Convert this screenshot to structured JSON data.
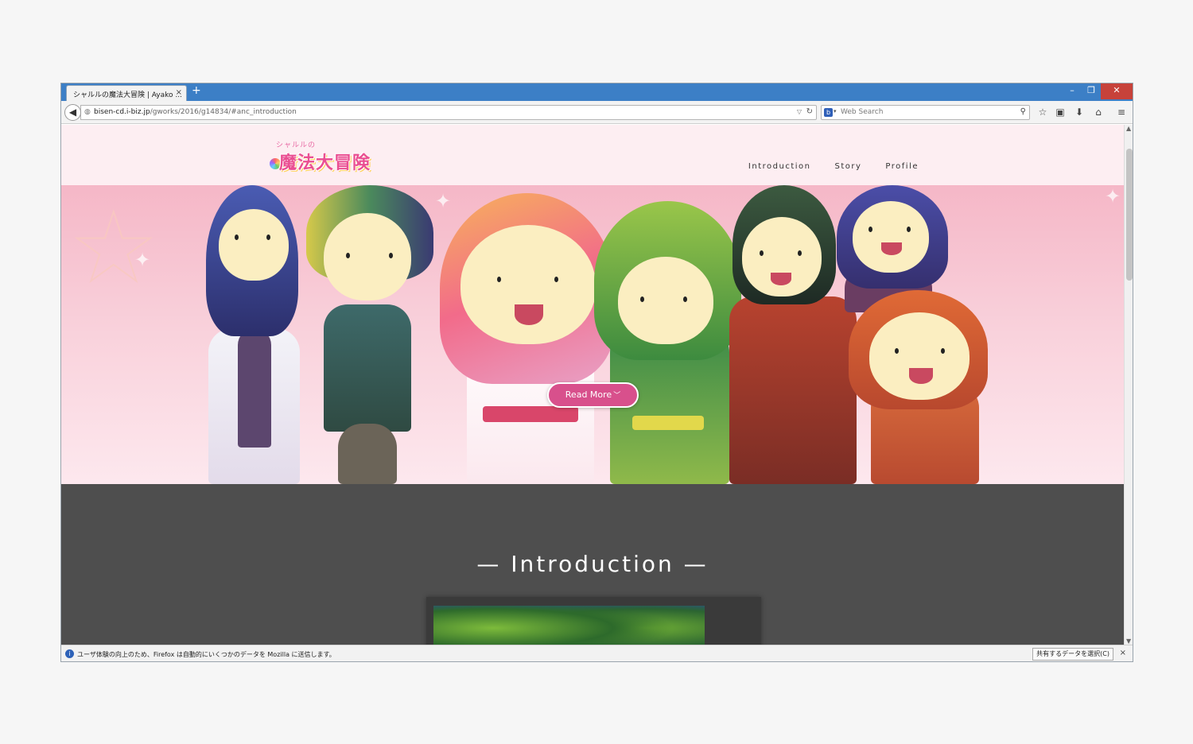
{
  "browser": {
    "tab_title": "シャルルの魔法大冒険 | Ayako ...",
    "tab_close": "×",
    "new_tab": "+",
    "win_minimize": "–",
    "win_restore": "❐",
    "win_close": "✕",
    "url_host": "bisen-cd.i-biz.jp",
    "url_path": "/gworks/2016/g14834/#anc_introduction",
    "search_placeholder": "Web Search",
    "search_engine_letter": "b"
  },
  "site": {
    "logo_sub": "シャルルの",
    "logo_main": "魔法大冒険",
    "nav": [
      "Introduction",
      "Story",
      "Profile"
    ]
  },
  "hero": {
    "read_more": "Read More"
  },
  "intro": {
    "title": "— Introduction —"
  },
  "notification": {
    "text": "ユーザ体験の向上のため、Firefox は自動的にいくつかのデータを Mozilla に送信します。",
    "button": "共有するデータを選択(C)",
    "close": "×"
  },
  "colors": {
    "accent_pink": "#d8508c",
    "tabstrip_blue": "#3c7fc6",
    "section_gray": "#4e4e4e"
  }
}
